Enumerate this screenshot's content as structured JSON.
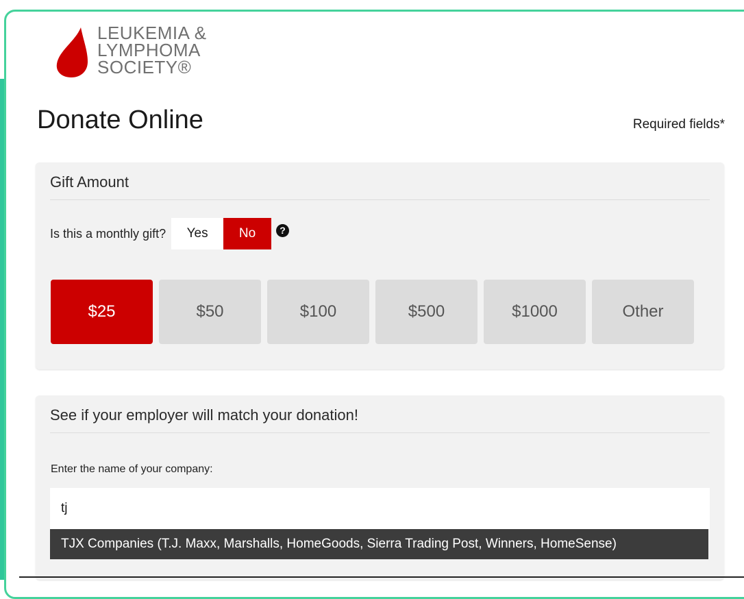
{
  "logo": {
    "line1": "LEUKEMIA &",
    "line2": "LYMPHOMA",
    "line3": "SOCIETY®",
    "brand_color": "#cc0000"
  },
  "page": {
    "title": "Donate Online",
    "required_note": "Required fields*"
  },
  "gift_amount": {
    "heading": "Gift Amount",
    "monthly_question": "Is this a monthly gift?",
    "yes_label": "Yes",
    "no_label": "No",
    "selected_monthly": "No",
    "help_icon": "question-circle-icon",
    "amounts": [
      {
        "label": "$25",
        "selected": true
      },
      {
        "label": "$50",
        "selected": false
      },
      {
        "label": "$100",
        "selected": false
      },
      {
        "label": "$500",
        "selected": false
      },
      {
        "label": "$1000",
        "selected": false
      },
      {
        "label": "Other",
        "selected": false
      }
    ]
  },
  "employer_match": {
    "heading": "See if your employer will match your donation!",
    "company_label": "Enter the name of your company:",
    "company_value": "tj",
    "suggestion": "TJX Companies (T.J. Maxx, Marshalls, HomeGoods, Sierra Trading Post, Winners, HomeSense)"
  },
  "colors": {
    "accent_red": "#cc0000",
    "frame_green": "#44d29b",
    "panel_bg": "#f2f2f2",
    "suggestion_bg": "#3c3c3c"
  }
}
